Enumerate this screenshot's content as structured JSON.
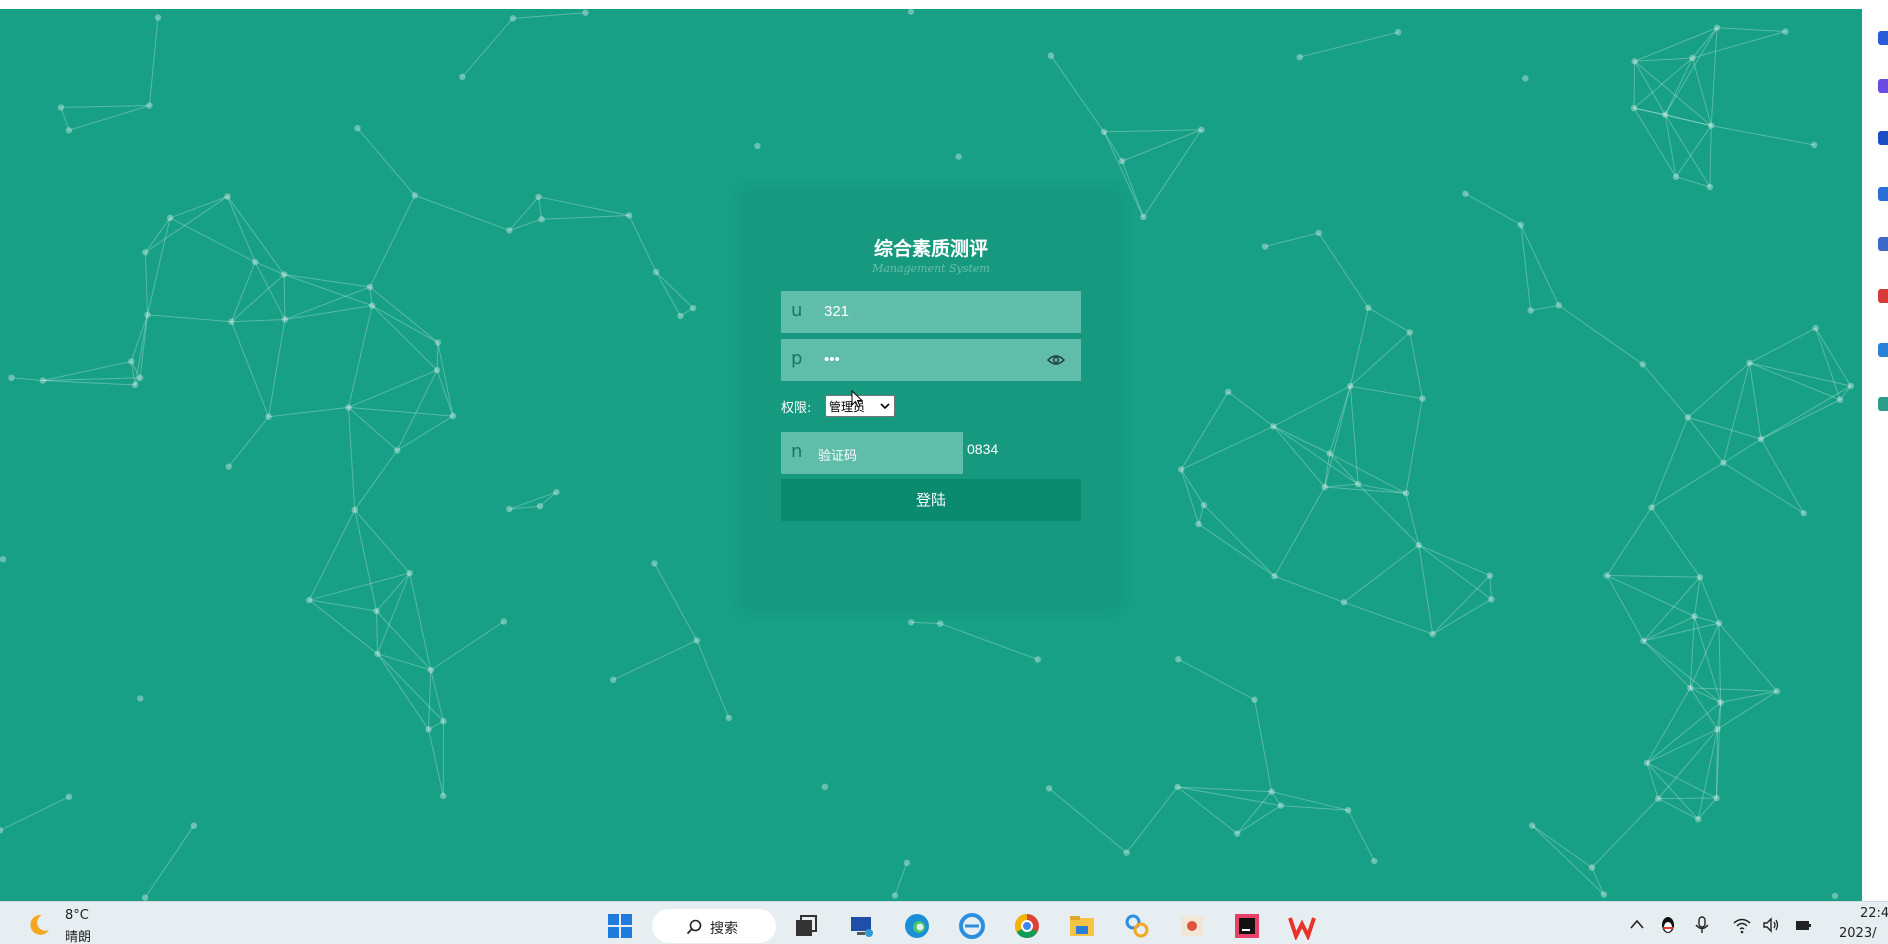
{
  "login": {
    "title": "综合素质测评",
    "subtitle": "Management System",
    "username_prefix": "u",
    "username_value": "321",
    "password_prefix": "p",
    "password_value": "•••",
    "role_label": "权限:",
    "role_selected": "管理员",
    "captcha_prefix": "n",
    "captcha_placeholder": "验证码",
    "captcha_code": "0834",
    "login_button": "登陆"
  },
  "taskbar": {
    "weather_temp": "8°C",
    "weather_desc": "晴朗",
    "search_label": "搜索",
    "clock_time": "22:4",
    "clock_date": "2023/"
  },
  "colors": {
    "background": "#17a085",
    "field": "#5fbda9",
    "button": "#0a8a6f"
  }
}
